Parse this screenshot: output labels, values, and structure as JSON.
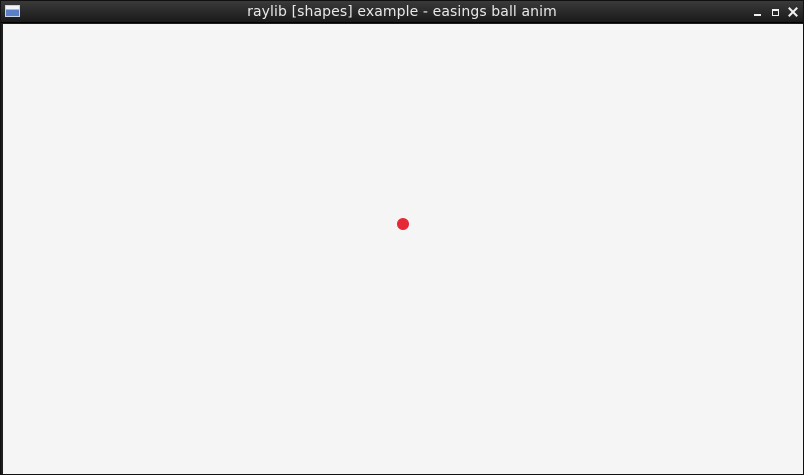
{
  "window": {
    "title": "raylib [shapes] example - easings ball anim",
    "icons": {
      "app": "window-app-icon",
      "minimize": "minimize-icon",
      "maximize": "maximize-icon",
      "close": "close-icon"
    }
  },
  "canvas": {
    "background_color": "#f5f5f5",
    "ball_color": "#e62937"
  }
}
